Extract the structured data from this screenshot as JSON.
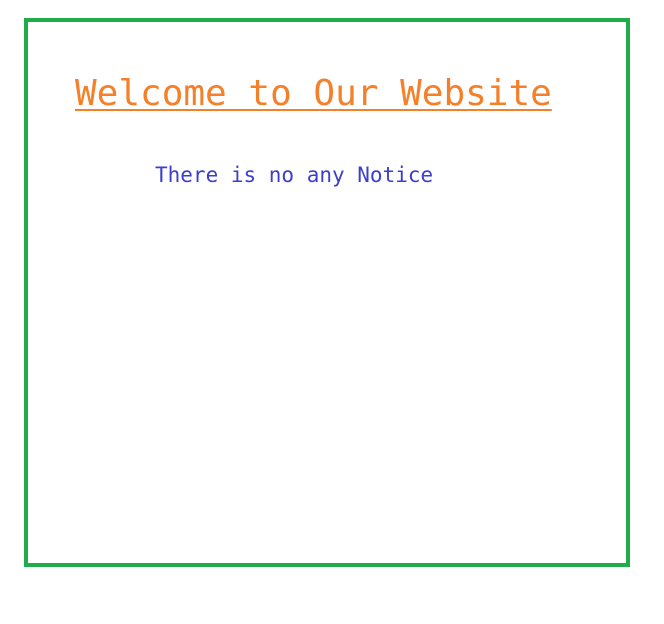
{
  "page": {
    "heading": "Welcome to Our Website",
    "notice": "There is no any Notice"
  },
  "colors": {
    "border": "#21ac4b",
    "heading": "#f5802a",
    "notice": "#3b3fcc",
    "background": "#ffffff"
  }
}
